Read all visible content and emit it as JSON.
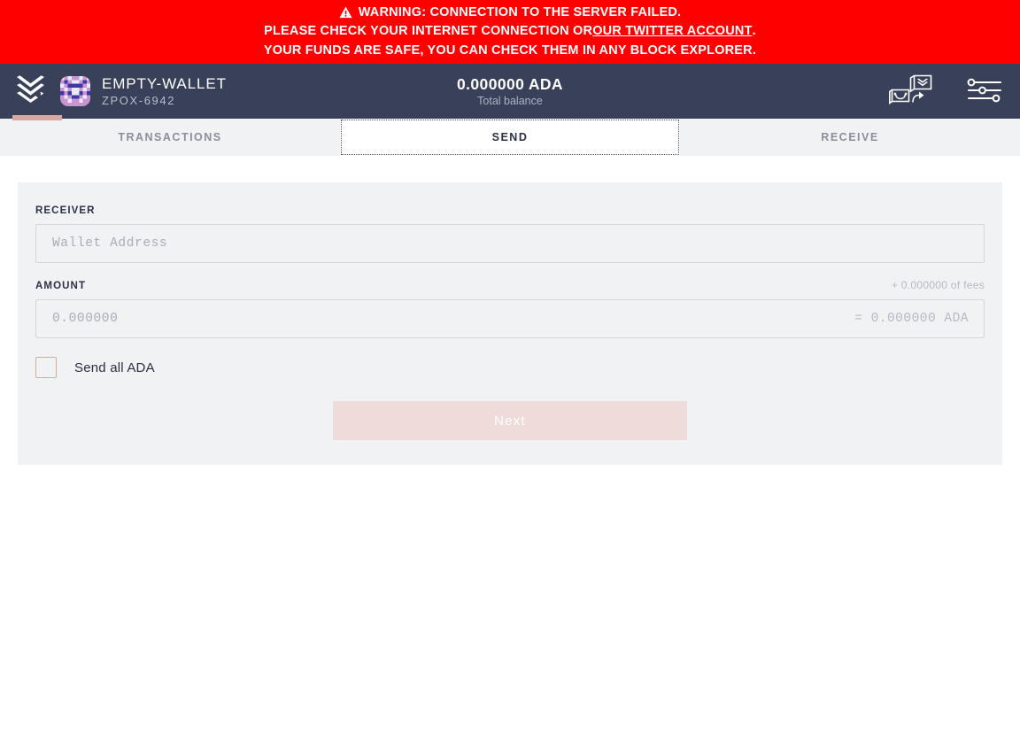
{
  "warning": {
    "icon": "warning-triangle-icon",
    "line1": "WARNING: CONNECTION TO THE SERVER FAILED.",
    "line2_prefix": "PLEASE CHECK YOUR INTERNET CONNECTION OR ",
    "line2_link": "OUR TWITTER ACCOUNT",
    "line2_suffix": ".",
    "line3": "YOUR FUNDS ARE SAFE, YOU CAN CHECK THEM IN ANY BLOCK EXPLORER.",
    "background_color": "#ff0000",
    "text_color": "#ffffff"
  },
  "header": {
    "logo_icon": "chevron-down-logo-icon",
    "background_color": "#38405a",
    "accent_color": "#d9a7a3",
    "avatar_icon": "wallet-identicon-avatar",
    "wallet_name": "EMPTY-WALLET",
    "wallet_id": "ZPOX-6942",
    "balance_amount": "0.000000 ADA",
    "balance_label": "Total balance",
    "actions": [
      {
        "name": "switch-wallet-icon",
        "label": "Switch wallet"
      },
      {
        "name": "settings-sliders-icon",
        "label": "Settings"
      }
    ]
  },
  "tabs": {
    "items": [
      {
        "label": "TRANSACTIONS",
        "name": "tab-transactions",
        "active": false
      },
      {
        "label": "SEND",
        "name": "tab-send",
        "active": true
      },
      {
        "label": "RECEIVE",
        "name": "tab-receive",
        "active": false
      }
    ]
  },
  "send_form": {
    "receiver_label": "RECEIVER",
    "receiver_value": "",
    "receiver_placeholder": "Wallet Address",
    "amount_label": "AMOUNT",
    "amount_value": "",
    "amount_placeholder": "0.000000",
    "fees_note": "+ 0.000000 of fees",
    "amount_equivalent": "= 0.000000 ADA",
    "send_all_label": "Send all ADA",
    "send_all_checked": false,
    "next_label": "Next",
    "next_disabled": true,
    "card_background": "#f1f2f4",
    "checkbox_border_color": "#dba8a3",
    "next_button_color": "#efdcda"
  }
}
